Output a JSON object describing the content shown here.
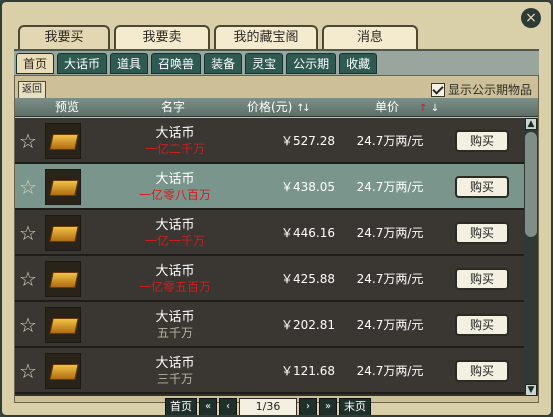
{
  "window": {
    "close_glyph": "×",
    "top_tabs": [
      {
        "label": "我要买",
        "active": true
      },
      {
        "label": "我要卖"
      },
      {
        "label": "我的藏宝阁"
      },
      {
        "label": "消息"
      }
    ],
    "sub_tabs": [
      {
        "label": "首页",
        "active": true
      },
      {
        "label": "大话币"
      },
      {
        "label": "道具"
      },
      {
        "label": "召唤兽"
      },
      {
        "label": "装备"
      },
      {
        "label": "灵宝"
      },
      {
        "label": "公示期"
      },
      {
        "label": "收藏"
      }
    ]
  },
  "panel": {
    "back_label": "返回",
    "show_public_label": "显示公示期物品",
    "columns": {
      "preview": "预览",
      "name": "名字",
      "price": "价格(元)",
      "unit": "单价"
    }
  },
  "rows": [
    {
      "name": "大话币",
      "amount": "一亿二千万",
      "amount_color": "#d11d1d",
      "price": "￥527.28",
      "unit_price": "24.7万两/元",
      "buy": "购买",
      "selected": false
    },
    {
      "name": "大话币",
      "amount": "一亿零八百万",
      "amount_color": "#d11d1d",
      "price": "￥438.05",
      "unit_price": "24.7万两/元",
      "buy": "购买",
      "selected": true
    },
    {
      "name": "大话币",
      "amount": "一亿一千万",
      "amount_color": "#d11d1d",
      "price": "￥446.16",
      "unit_price": "24.7万两/元",
      "buy": "购买",
      "selected": false
    },
    {
      "name": "大话币",
      "amount": "一亿零五百万",
      "amount_color": "#d11d1d",
      "price": "￥425.88",
      "unit_price": "24.7万两/元",
      "buy": "购买",
      "selected": false
    },
    {
      "name": "大话币",
      "amount": "五千万",
      "amount_color": "#b7b2a5",
      "price": "￥202.81",
      "unit_price": "24.7万两/元",
      "buy": "购买",
      "selected": false
    },
    {
      "name": "大话币",
      "amount": "三千万",
      "amount_color": "#b7b2a5",
      "price": "￥121.68",
      "unit_price": "24.7万两/元",
      "buy": "购买",
      "selected": false
    }
  ],
  "pager": {
    "first": "首页",
    "page": "1/36",
    "last": "末页"
  }
}
